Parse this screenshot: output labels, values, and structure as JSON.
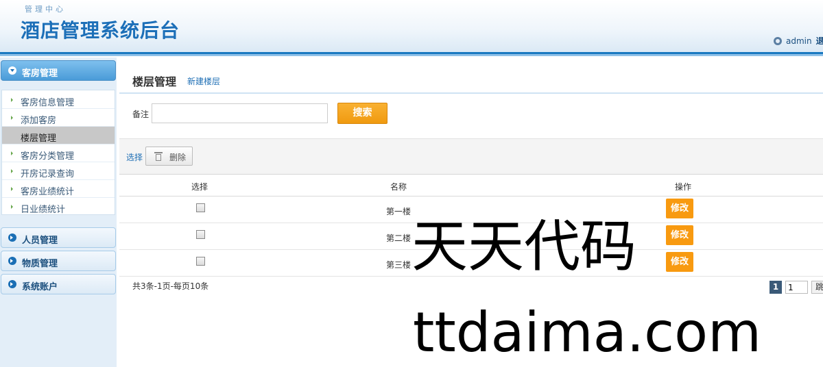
{
  "header": {
    "subtitle": "管理中心",
    "title": "酒店管理系统后台",
    "username": "admin",
    "logout_label": "退"
  },
  "sidebar": {
    "groups": [
      {
        "label": "客房管理",
        "icon": "chevron-down-icon",
        "expanded": true
      },
      {
        "label": "人员管理",
        "icon": "chevron-right-icon",
        "expanded": false
      },
      {
        "label": "物质管理",
        "icon": "chevron-right-icon",
        "expanded": false
      },
      {
        "label": "系统账户",
        "icon": "chevron-right-icon",
        "expanded": false
      }
    ],
    "items": [
      {
        "label": "客房信息管理"
      },
      {
        "label": "添加客房"
      },
      {
        "label": "楼层管理",
        "active": true
      },
      {
        "label": "客房分类管理"
      },
      {
        "label": "开房记录查询"
      },
      {
        "label": "客房业绩统计"
      },
      {
        "label": "日业绩统计"
      }
    ]
  },
  "main": {
    "title": "楼层管理",
    "new_link": "新建楼层",
    "search": {
      "label": "备注",
      "value": "",
      "button": "搜索"
    },
    "toolbar": {
      "select_label": "选择",
      "delete_label": "删除"
    },
    "table": {
      "headers": [
        "选择",
        "名称",
        "操作"
      ],
      "rows": [
        {
          "name": "第一楼",
          "action": "修改"
        },
        {
          "name": "第二楼",
          "action": "修改"
        },
        {
          "name": "第三楼",
          "action": "修改"
        }
      ]
    },
    "pager": {
      "info": "共3条-1页-每页10条",
      "current_page": "1",
      "input_value": "1",
      "jump_label": "跳"
    }
  },
  "watermark": {
    "cn": "天天代码",
    "en": "ttdaima.com"
  },
  "colors": {
    "brand": "#1c6fb8",
    "accent_orange": "#f89a10",
    "sidebar_bg": "#e3eef8"
  }
}
